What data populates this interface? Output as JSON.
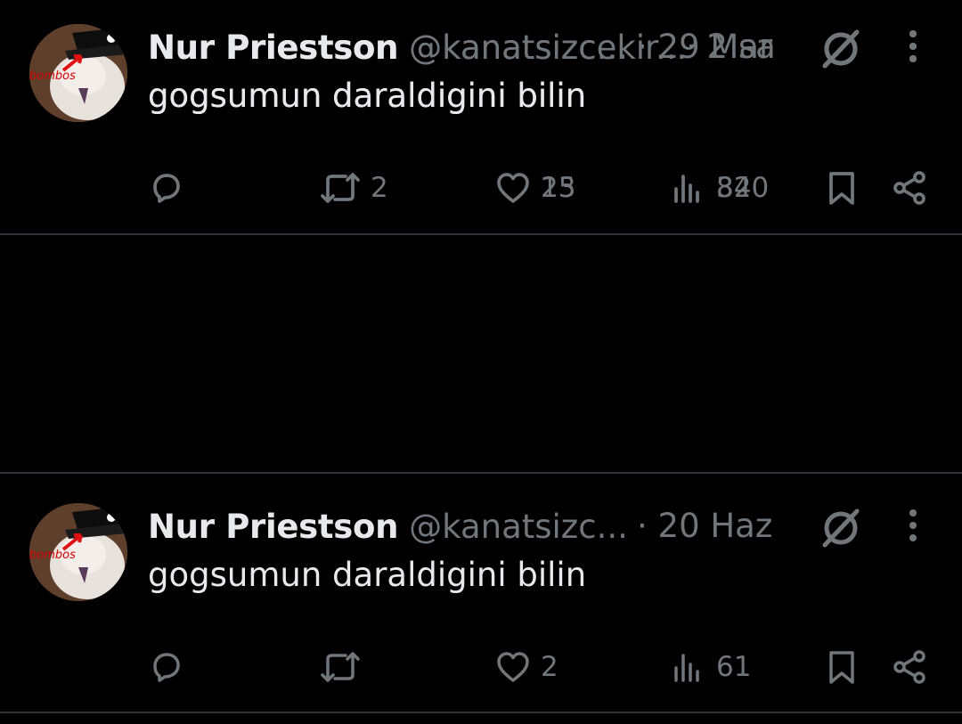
{
  "tweets": [
    {
      "author": "Nur Priestson",
      "handle": "@kanatsizcekir...",
      "time": "· 2 sa",
      "text": "gogsumun daraldigini bilin",
      "replies": "",
      "retweets": "2",
      "likes": "25",
      "views": "320"
    },
    {
      "author": "Nur Priestson",
      "handle": "@kanatsizc...",
      "time": "· 20 Haz",
      "text": "gogsumun daraldigini bilin",
      "replies": "",
      "retweets": "",
      "likes": "2",
      "views": "61"
    },
    {
      "author": "Nur Priestson",
      "handle": "@kanatsizc...",
      "time": "· 29 Mar",
      "text": "gogsumun daraldigini bilin",
      "replies": "",
      "retweets": "",
      "likes": "13",
      "views": "84"
    }
  ],
  "avatar_text": "bombos",
  "icons": {
    "reply": "reply-icon",
    "retweet": "retweet-icon",
    "like": "heart-icon",
    "views": "views-icon",
    "bookmark": "bookmark-icon",
    "share": "share-icon",
    "grok": "grok-icon",
    "more": "more-icon"
  },
  "colors": {
    "background": "#000000",
    "text": "#e7e9ea",
    "muted": "#71767b",
    "divider": "#2f3336"
  }
}
